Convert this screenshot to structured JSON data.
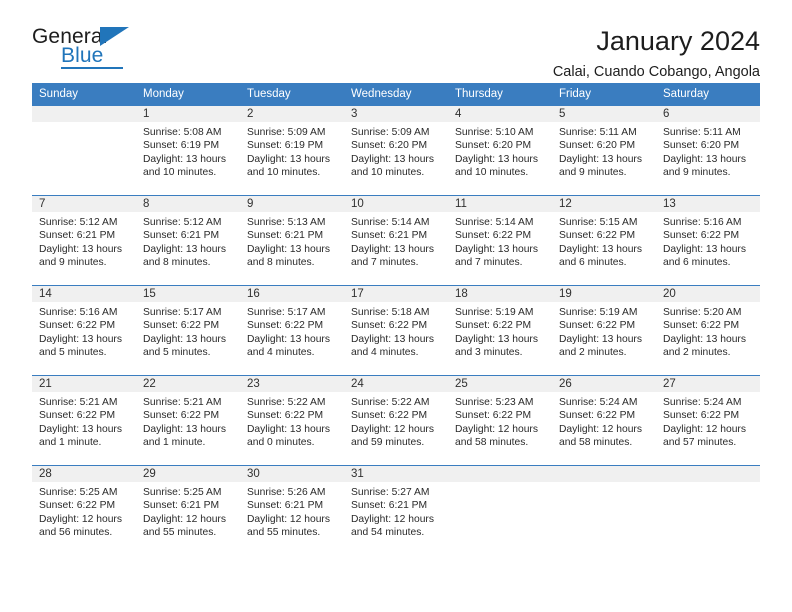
{
  "brand": {
    "name_top": "General",
    "name_bottom": "Blue",
    "accent_color": "#2175ba"
  },
  "header": {
    "title": "January 2024",
    "subtitle": "Calai, Cuando Cobango, Angola"
  },
  "calendar": {
    "header_bg": "#3a7dc0",
    "daynum_bg": "#f0f0f0",
    "weekday_headers": [
      "Sunday",
      "Monday",
      "Tuesday",
      "Wednesday",
      "Thursday",
      "Friday",
      "Saturday"
    ],
    "weeks": [
      [
        {
          "day": "",
          "sunrise": "",
          "sunset": "",
          "daylight1": "",
          "daylight2": "",
          "blank": true
        },
        {
          "day": "1",
          "sunrise": "Sunrise: 5:08 AM",
          "sunset": "Sunset: 6:19 PM",
          "daylight1": "Daylight: 13 hours",
          "daylight2": "and 10 minutes."
        },
        {
          "day": "2",
          "sunrise": "Sunrise: 5:09 AM",
          "sunset": "Sunset: 6:19 PM",
          "daylight1": "Daylight: 13 hours",
          "daylight2": "and 10 minutes."
        },
        {
          "day": "3",
          "sunrise": "Sunrise: 5:09 AM",
          "sunset": "Sunset: 6:20 PM",
          "daylight1": "Daylight: 13 hours",
          "daylight2": "and 10 minutes."
        },
        {
          "day": "4",
          "sunrise": "Sunrise: 5:10 AM",
          "sunset": "Sunset: 6:20 PM",
          "daylight1": "Daylight: 13 hours",
          "daylight2": "and 10 minutes."
        },
        {
          "day": "5",
          "sunrise": "Sunrise: 5:11 AM",
          "sunset": "Sunset: 6:20 PM",
          "daylight1": "Daylight: 13 hours",
          "daylight2": "and 9 minutes."
        },
        {
          "day": "6",
          "sunrise": "Sunrise: 5:11 AM",
          "sunset": "Sunset: 6:20 PM",
          "daylight1": "Daylight: 13 hours",
          "daylight2": "and 9 minutes."
        }
      ],
      [
        {
          "day": "7",
          "sunrise": "Sunrise: 5:12 AM",
          "sunset": "Sunset: 6:21 PM",
          "daylight1": "Daylight: 13 hours",
          "daylight2": "and 9 minutes."
        },
        {
          "day": "8",
          "sunrise": "Sunrise: 5:12 AM",
          "sunset": "Sunset: 6:21 PM",
          "daylight1": "Daylight: 13 hours",
          "daylight2": "and 8 minutes."
        },
        {
          "day": "9",
          "sunrise": "Sunrise: 5:13 AM",
          "sunset": "Sunset: 6:21 PM",
          "daylight1": "Daylight: 13 hours",
          "daylight2": "and 8 minutes."
        },
        {
          "day": "10",
          "sunrise": "Sunrise: 5:14 AM",
          "sunset": "Sunset: 6:21 PM",
          "daylight1": "Daylight: 13 hours",
          "daylight2": "and 7 minutes."
        },
        {
          "day": "11",
          "sunrise": "Sunrise: 5:14 AM",
          "sunset": "Sunset: 6:22 PM",
          "daylight1": "Daylight: 13 hours",
          "daylight2": "and 7 minutes."
        },
        {
          "day": "12",
          "sunrise": "Sunrise: 5:15 AM",
          "sunset": "Sunset: 6:22 PM",
          "daylight1": "Daylight: 13 hours",
          "daylight2": "and 6 minutes."
        },
        {
          "day": "13",
          "sunrise": "Sunrise: 5:16 AM",
          "sunset": "Sunset: 6:22 PM",
          "daylight1": "Daylight: 13 hours",
          "daylight2": "and 6 minutes."
        }
      ],
      [
        {
          "day": "14",
          "sunrise": "Sunrise: 5:16 AM",
          "sunset": "Sunset: 6:22 PM",
          "daylight1": "Daylight: 13 hours",
          "daylight2": "and 5 minutes."
        },
        {
          "day": "15",
          "sunrise": "Sunrise: 5:17 AM",
          "sunset": "Sunset: 6:22 PM",
          "daylight1": "Daylight: 13 hours",
          "daylight2": "and 5 minutes."
        },
        {
          "day": "16",
          "sunrise": "Sunrise: 5:17 AM",
          "sunset": "Sunset: 6:22 PM",
          "daylight1": "Daylight: 13 hours",
          "daylight2": "and 4 minutes."
        },
        {
          "day": "17",
          "sunrise": "Sunrise: 5:18 AM",
          "sunset": "Sunset: 6:22 PM",
          "daylight1": "Daylight: 13 hours",
          "daylight2": "and 4 minutes."
        },
        {
          "day": "18",
          "sunrise": "Sunrise: 5:19 AM",
          "sunset": "Sunset: 6:22 PM",
          "daylight1": "Daylight: 13 hours",
          "daylight2": "and 3 minutes."
        },
        {
          "day": "19",
          "sunrise": "Sunrise: 5:19 AM",
          "sunset": "Sunset: 6:22 PM",
          "daylight1": "Daylight: 13 hours",
          "daylight2": "and 2 minutes."
        },
        {
          "day": "20",
          "sunrise": "Sunrise: 5:20 AM",
          "sunset": "Sunset: 6:22 PM",
          "daylight1": "Daylight: 13 hours",
          "daylight2": "and 2 minutes."
        }
      ],
      [
        {
          "day": "21",
          "sunrise": "Sunrise: 5:21 AM",
          "sunset": "Sunset: 6:22 PM",
          "daylight1": "Daylight: 13 hours",
          "daylight2": "and 1 minute."
        },
        {
          "day": "22",
          "sunrise": "Sunrise: 5:21 AM",
          "sunset": "Sunset: 6:22 PM",
          "daylight1": "Daylight: 13 hours",
          "daylight2": "and 1 minute."
        },
        {
          "day": "23",
          "sunrise": "Sunrise: 5:22 AM",
          "sunset": "Sunset: 6:22 PM",
          "daylight1": "Daylight: 13 hours",
          "daylight2": "and 0 minutes."
        },
        {
          "day": "24",
          "sunrise": "Sunrise: 5:22 AM",
          "sunset": "Sunset: 6:22 PM",
          "daylight1": "Daylight: 12 hours",
          "daylight2": "and 59 minutes."
        },
        {
          "day": "25",
          "sunrise": "Sunrise: 5:23 AM",
          "sunset": "Sunset: 6:22 PM",
          "daylight1": "Daylight: 12 hours",
          "daylight2": "and 58 minutes."
        },
        {
          "day": "26",
          "sunrise": "Sunrise: 5:24 AM",
          "sunset": "Sunset: 6:22 PM",
          "daylight1": "Daylight: 12 hours",
          "daylight2": "and 58 minutes."
        },
        {
          "day": "27",
          "sunrise": "Sunrise: 5:24 AM",
          "sunset": "Sunset: 6:22 PM",
          "daylight1": "Daylight: 12 hours",
          "daylight2": "and 57 minutes."
        }
      ],
      [
        {
          "day": "28",
          "sunrise": "Sunrise: 5:25 AM",
          "sunset": "Sunset: 6:22 PM",
          "daylight1": "Daylight: 12 hours",
          "daylight2": "and 56 minutes."
        },
        {
          "day": "29",
          "sunrise": "Sunrise: 5:25 AM",
          "sunset": "Sunset: 6:21 PM",
          "daylight1": "Daylight: 12 hours",
          "daylight2": "and 55 minutes."
        },
        {
          "day": "30",
          "sunrise": "Sunrise: 5:26 AM",
          "sunset": "Sunset: 6:21 PM",
          "daylight1": "Daylight: 12 hours",
          "daylight2": "and 55 minutes."
        },
        {
          "day": "31",
          "sunrise": "Sunrise: 5:27 AM",
          "sunset": "Sunset: 6:21 PM",
          "daylight1": "Daylight: 12 hours",
          "daylight2": "and 54 minutes."
        },
        {
          "day": "",
          "sunrise": "",
          "sunset": "",
          "daylight1": "",
          "daylight2": "",
          "blank": true
        },
        {
          "day": "",
          "sunrise": "",
          "sunset": "",
          "daylight1": "",
          "daylight2": "",
          "blank": true
        },
        {
          "day": "",
          "sunrise": "",
          "sunset": "",
          "daylight1": "",
          "daylight2": "",
          "blank": true
        }
      ]
    ]
  }
}
